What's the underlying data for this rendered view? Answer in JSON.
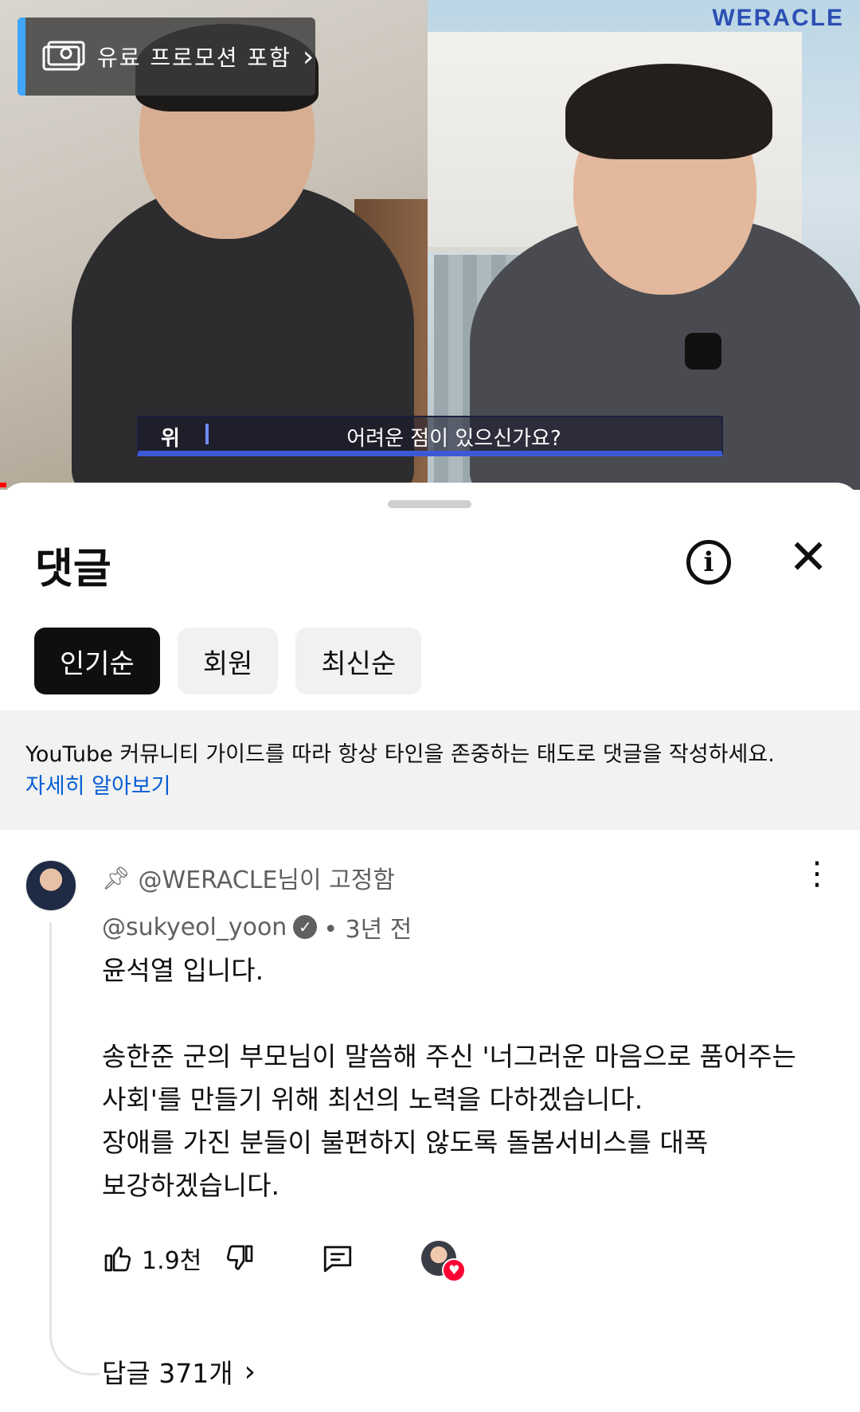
{
  "video": {
    "brand": "WERACLE",
    "promo_label": "유료 프로모션 포함",
    "subtitle_speaker": "위",
    "subtitle_text": "어려운 점이 있으신가요?"
  },
  "sheet": {
    "title": "댓글",
    "chips": [
      "인기순",
      "회원",
      "최신순"
    ],
    "active_chip": "인기순",
    "notice_text": "YouTube 커뮤니티 가이드를 따라 항상 타인을 존중하는 태도로 댓글을 작성하세요.",
    "notice_link": "자세히 알아보기"
  },
  "comment": {
    "pinned_by": "@WERACLE님이 고정함",
    "author": "@sukyeol_yoon",
    "time": "• 3년 전",
    "lines": [
      "윤석열 입니다.",
      "",
      "송한준 군의 부모님이 말씀해 주신 '너그러운 마음으로 품어주는",
      "사회'를 만들기 위해 최선의 노력을 다하겠습니다.",
      "장애를 가진 분들이 불편하지 않도록 돌봄서비스를 대폭",
      "보강하겠습니다."
    ],
    "likes": "1.9천",
    "replies_label": "답글 371개"
  },
  "colors": {
    "link": "#065fd4",
    "brand": "#2c4fb4",
    "heart": "#ff0033"
  },
  "icons": [
    "promo-ticket-icon",
    "chevron-right-icon",
    "info-icon",
    "close-icon",
    "pin-icon",
    "verified-icon",
    "more-vert-icon",
    "thumb-up-icon",
    "thumb-down-icon",
    "reply-icon",
    "creator-heart-icon"
  ]
}
